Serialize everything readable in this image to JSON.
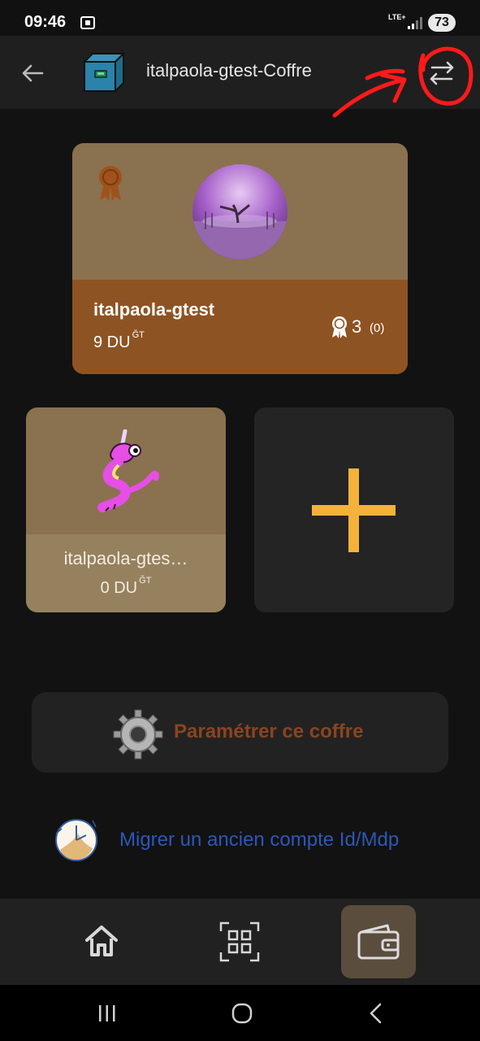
{
  "status_bar": {
    "time": "09:46",
    "network": "LTE+",
    "battery": "73"
  },
  "app_bar": {
    "title": "italpaola-gtest-Coffre"
  },
  "main_wallet": {
    "name": "italpaola-gtest",
    "balance": "9 DU",
    "unit_sup": "ĞT",
    "certifications": "3",
    "pending_certifications": "(0)"
  },
  "derivation": {
    "name": "italpaola-gtes…",
    "balance": "0 DU",
    "unit_sup": "ĞT"
  },
  "settings_button": {
    "label": "Paramétrer ce coffre"
  },
  "migrate_link": {
    "label": "Migrer un ancien compte Id/Mdp"
  },
  "bottom_nav": {
    "items": [
      "home-icon",
      "qr-scan-icon",
      "wallet-icon"
    ],
    "active": "wallet-icon"
  },
  "colors": {
    "background": "#121212",
    "card_top": "#8a714f",
    "card_bottom": "#8e5323",
    "accent_plus": "#f4b23b",
    "settings_text": "#8a4420",
    "link": "#2e57b7",
    "annotation_red": "#ff1a1a"
  }
}
